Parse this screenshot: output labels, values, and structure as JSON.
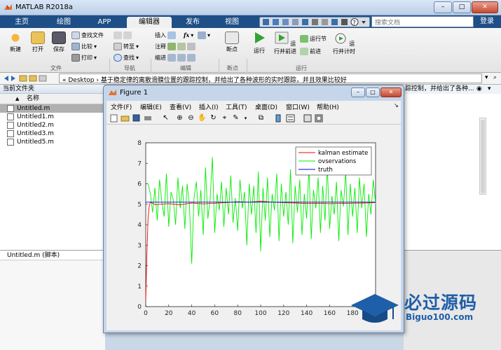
{
  "app": {
    "title": "MATLAB R2018a",
    "tabs": [
      "主页",
      "绘图",
      "APP",
      "编辑器",
      "发布",
      "视图"
    ],
    "active_tab": "编辑器",
    "search_placeholder": "搜索文档",
    "login_label": "登录",
    "help_icon_text": "?"
  },
  "ribbon": {
    "new_label": "新建",
    "open_label": "打开",
    "save_label": "保存",
    "find_files": "查找文件",
    "compare": "比较",
    "print": "打印",
    "go_to": "转至",
    "find": "查找",
    "insert": "插入",
    "comment": "注释",
    "indent": "缩进",
    "breakpoints": "断点",
    "run": "运行",
    "run_advance": "运行并前进",
    "run_section": "运行节",
    "advance": "前进",
    "run_time": "运行并计时",
    "fx": "fx",
    "groups": [
      "文件",
      "导航",
      "编辑",
      "断点",
      "运行"
    ]
  },
  "address": {
    "prefix": "« Desktop ›",
    "path": "基于稳定律的离散滑膜位置的跟踪控制，并给出了各种波形的实时跟踪，并且效果比较好"
  },
  "current_folder": {
    "title": "当前文件夹",
    "column_name": "名称",
    "sort_indicator": "▲",
    "files": [
      "Untitled.m",
      "Untitled1.m",
      "Untitled2.m",
      "Untitled3.m",
      "Untitled5.m"
    ],
    "details_label": "Untitled.m  (脚本)"
  },
  "right_panel": {
    "title": "踪控制，并给出了各种..."
  },
  "figure": {
    "title": "Figure 1",
    "menus": [
      "文件(F)",
      "编辑(E)",
      "查看(V)",
      "插入(I)",
      "工具(T)",
      "桌面(D)",
      "窗口(W)",
      "帮助(H)"
    ]
  },
  "chart_data": {
    "type": "line",
    "title": "",
    "xlabel": "",
    "ylabel": "",
    "xlim": [
      0,
      200
    ],
    "ylim": [
      0,
      8
    ],
    "xticks": [
      0,
      20,
      40,
      60,
      80,
      100,
      120,
      140,
      160,
      180
    ],
    "yticks": [
      0,
      1,
      2,
      3,
      4,
      5,
      6,
      7,
      8
    ],
    "grid": false,
    "legend_position": "top-right",
    "series": [
      {
        "name": "kalman estimate",
        "color": "#ff0000",
        "x": [
          0,
          1,
          2,
          3,
          4,
          6,
          8,
          12,
          20,
          30,
          40,
          50,
          60,
          70,
          80,
          90,
          100,
          110,
          120,
          130,
          140,
          150,
          160,
          170,
          180,
          190,
          200
        ],
        "y": [
          0.3,
          2.5,
          4.3,
          4.9,
          5.1,
          5.05,
          4.98,
          5.0,
          5.03,
          4.97,
          5.06,
          5.02,
          5.05,
          5.08,
          5.12,
          5.1,
          5.15,
          5.1,
          5.08,
          5.06,
          5.04,
          5.05,
          5.03,
          5.04,
          5.05,
          5.06,
          5.08
        ]
      },
      {
        "name": "ovservations",
        "color": "#00ee00",
        "x": [
          2,
          4,
          6,
          8,
          10,
          12,
          14,
          16,
          18,
          20,
          22,
          24,
          26,
          28,
          30,
          32,
          34,
          36,
          38,
          40,
          42,
          44,
          46,
          48,
          50,
          52,
          54,
          56,
          58,
          60,
          62,
          64,
          66,
          68,
          70,
          72,
          74,
          76,
          78,
          80,
          82,
          84,
          86,
          88,
          90,
          92,
          94,
          96,
          98,
          100,
          102,
          104,
          106,
          108,
          110,
          112,
          114,
          116,
          118,
          120,
          122,
          124,
          126,
          128,
          130,
          132,
          134,
          136,
          138,
          140,
          142,
          144,
          146,
          148,
          150,
          152,
          154,
          156,
          158,
          160,
          162,
          164,
          166,
          168,
          170,
          172,
          174,
          176,
          178,
          180,
          182,
          184,
          186,
          188,
          190,
          192,
          194,
          196,
          198,
          200
        ],
        "y": [
          6.0,
          5.5,
          4.6,
          5.8,
          4.2,
          6.2,
          5.1,
          4.4,
          6.5,
          3.9,
          5.6,
          5.2,
          4.0,
          6.3,
          4.8,
          5.9,
          3.8,
          6.0,
          5.0,
          2.1,
          5.3,
          6.1,
          4.4,
          5.7,
          3.5,
          6.8,
          4.3,
          5.2,
          7.3,
          3.6,
          5.5,
          4.7,
          6.1,
          3.9,
          5.8,
          4.5,
          6.4,
          4.1,
          5.3,
          3.7,
          6.2,
          4.8,
          5.6,
          3.0,
          6.0,
          4.5,
          5.9,
          3.6,
          6.6,
          2.7,
          5.8,
          4.2,
          6.3,
          3.4,
          5.5,
          4.7,
          6.5,
          3.2,
          6.0,
          4.4,
          5.6,
          4.0,
          6.7,
          3.1,
          5.9,
          4.6,
          6.2,
          3.5,
          5.5,
          4.3,
          6.8,
          3.3,
          5.7,
          4.8,
          6.3,
          3.6,
          5.9,
          4.2,
          6.9,
          3.8,
          5.4,
          4.5,
          6.1,
          3.2,
          5.7,
          4.9,
          6.6,
          3.5,
          6.0,
          4.4,
          5.8,
          3.6,
          6.3,
          4.8,
          6.0,
          3.4,
          5.5,
          4.5,
          6.2,
          5.0
        ]
      },
      {
        "name": "truth",
        "color": "#0000ff",
        "x": [
          0,
          200
        ],
        "y": [
          5.1,
          5.1
        ]
      }
    ]
  },
  "watermark": {
    "brand": "必过源码",
    "url": "Biguo100.com"
  },
  "colors": {
    "tabbar": "#1e4f86",
    "ribbon": "#f0f0f0",
    "plot_bg": "#ffffff",
    "window_frame": "#c6d6ea"
  }
}
